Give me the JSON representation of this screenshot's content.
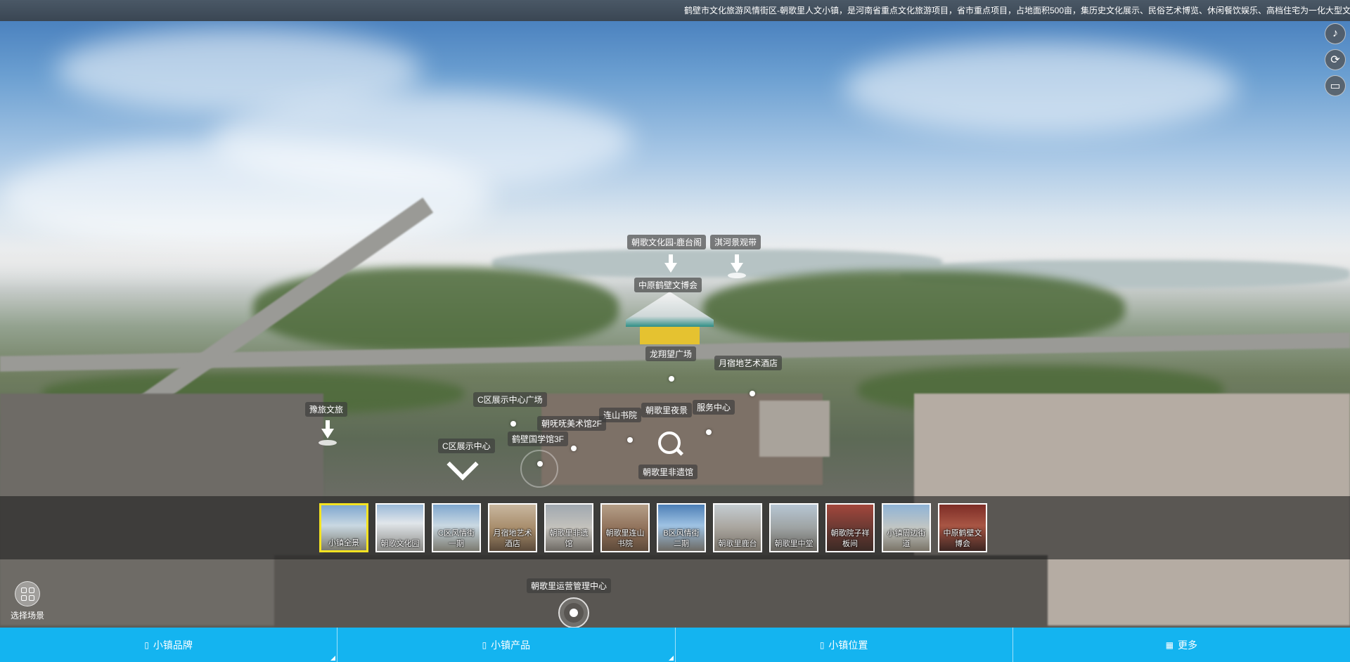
{
  "ticker": {
    "text": "鹤壁市文化旅游风情街区-朝歌里人文小镇，是河南省重点文化旅游项目，省市重点项目，占地面积500亩，集历史文化展示、民俗艺术博览、休闲餐饮娱乐、高档住宅为一化大型文"
  },
  "side_icons": [
    "music-icon",
    "autorotate-icon",
    "vr-glasses-icon"
  ],
  "hotspots": [
    {
      "id": "hotspot-chaoge-park-lutaige",
      "label": "朝歌文化园-鹿台阁"
    },
    {
      "id": "hotspot-qihe-landscape",
      "label": "淇河景观带"
    },
    {
      "id": "hotspot-zhongyuan-expo",
      "label": "中原鹤壁文博会"
    },
    {
      "id": "hotspot-longtanwang-square",
      "label": "龙翔望广场"
    },
    {
      "id": "hotspot-yuesudi-hotel",
      "label": "月宿地艺术酒店"
    },
    {
      "id": "hotspot-c-exhibition-square",
      "label": "C区展示中心广场"
    },
    {
      "id": "hotspot-lianshan-academy",
      "label": "连山书院"
    },
    {
      "id": "hotspot-chaogeli-night",
      "label": "朝歌里夜景"
    },
    {
      "id": "hotspot-service-center",
      "label": "服务中心"
    },
    {
      "id": "hotspot-art-gallery",
      "label": "朝呒呒美术馆2F"
    },
    {
      "id": "hotspot-yuxuan-tourism",
      "label": "豫旅文旅"
    },
    {
      "id": "hotspot-hebi-guoxue",
      "label": "鹤壁国学馆3F"
    },
    {
      "id": "hotspot-c-exhibition-center",
      "label": "C区展示中心"
    },
    {
      "id": "hotspot-intangible-heritage",
      "label": "朝歌里非遗馆"
    },
    {
      "id": "hotspot-operations-center",
      "label": "朝歌里运营管理中心"
    }
  ],
  "thumbnails": [
    {
      "label": "小镇全景",
      "selected": true
    },
    {
      "label": "朝歌文化园",
      "selected": false
    },
    {
      "label": "C区风情街一期",
      "selected": false
    },
    {
      "label": "月宿地艺术酒店",
      "selected": false
    },
    {
      "label": "朝歌里非遗馆",
      "selected": false
    },
    {
      "label": "朝歌里连山书院",
      "selected": false
    },
    {
      "label": "B区风情街二期",
      "selected": false
    },
    {
      "label": "朝歌里鹿台",
      "selected": false
    },
    {
      "label": "朝歌里中堂",
      "selected": false
    },
    {
      "label": "朝歌院子祥板间",
      "selected": false
    },
    {
      "label": "小镇周边街道",
      "selected": false
    },
    {
      "label": "中原鹤壁文博会",
      "selected": false
    }
  ],
  "scene_select": {
    "label": "选择场景"
  },
  "bottom_menu": [
    {
      "label": "小镇品牌",
      "icon": "document-icon"
    },
    {
      "label": "小镇产品",
      "icon": "document-icon"
    },
    {
      "label": "小镇位置",
      "icon": "document-icon"
    },
    {
      "label": "更多",
      "icon": "grid-icon"
    }
  ],
  "colors": {
    "menu_bar": "#14b4f0",
    "selected_thumb_border": "#f4e321"
  }
}
